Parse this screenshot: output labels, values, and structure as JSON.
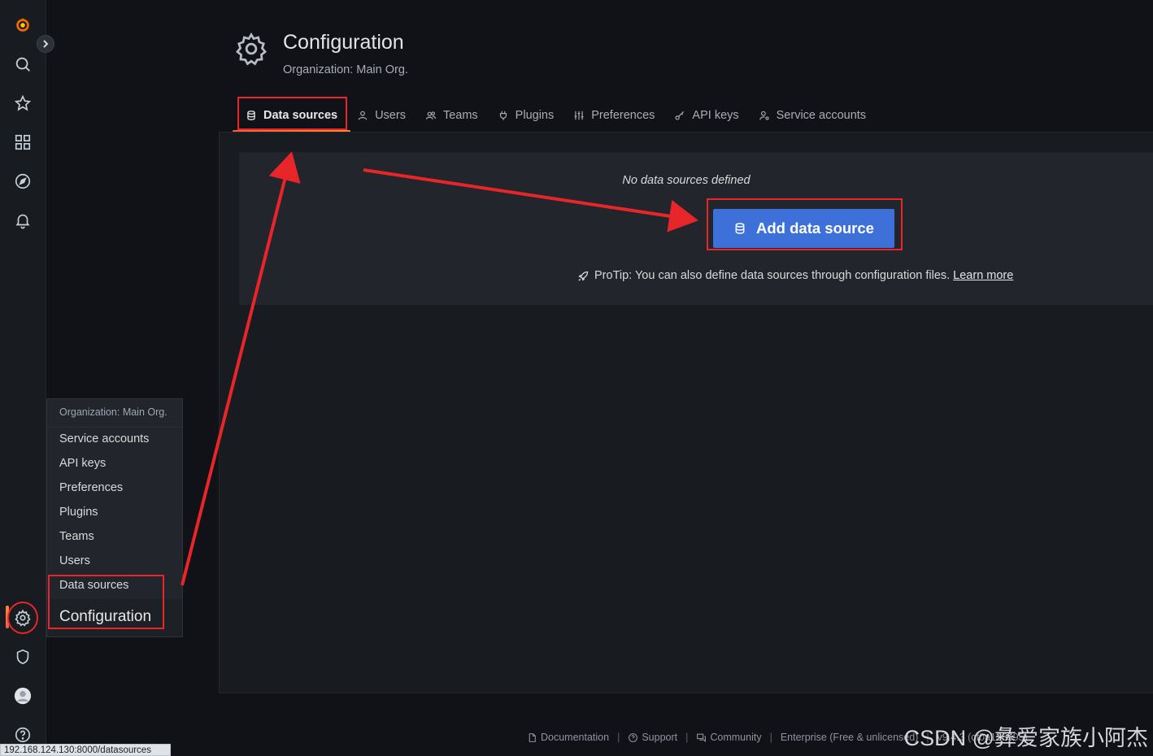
{
  "sidebar": {
    "icons": [
      "grafana-logo-icon",
      "search-icon",
      "star-icon",
      "dashboards-icon",
      "explore-compass-icon",
      "bell-icon",
      "gear-icon",
      "shield-icon",
      "avatar-icon",
      "help-icon"
    ]
  },
  "flyout": {
    "header": "Organization: Main Org.",
    "items": [
      {
        "label": "Service accounts"
      },
      {
        "label": "API keys"
      },
      {
        "label": "Preferences"
      },
      {
        "label": "Plugins"
      },
      {
        "label": "Teams"
      },
      {
        "label": "Users"
      },
      {
        "label": "Data sources"
      }
    ],
    "title": "Configuration"
  },
  "header": {
    "title": "Configuration",
    "subtitle": "Organization: Main Org."
  },
  "tabs": [
    {
      "label": "Data sources",
      "icon": "database-icon",
      "active": true
    },
    {
      "label": "Users",
      "icon": "user-icon"
    },
    {
      "label": "Teams",
      "icon": "users-icon"
    },
    {
      "label": "Plugins",
      "icon": "plug-icon"
    },
    {
      "label": "Preferences",
      "icon": "sliders-icon"
    },
    {
      "label": "API keys",
      "icon": "key-icon"
    },
    {
      "label": "Service accounts",
      "icon": "user-cog-icon"
    }
  ],
  "empty_state": {
    "message": "No data sources defined",
    "button": "Add data source",
    "protip": "ProTip: You can also define data sources through configuration files.",
    "learn_more": "Learn more"
  },
  "footer": {
    "documentation": "Documentation",
    "support": "Support",
    "community": "Community",
    "enterprise": "Enterprise (Free & unlicensed)",
    "version": "v9.4.3 (cf0a135595)"
  },
  "watermark": "CSDN @彝爱家族小阿杰",
  "status_url": "192.168.124.130:8000/datasources",
  "colors": {
    "accent": "#3d71d9",
    "annotation": "#e8262a",
    "background": "#111217"
  }
}
